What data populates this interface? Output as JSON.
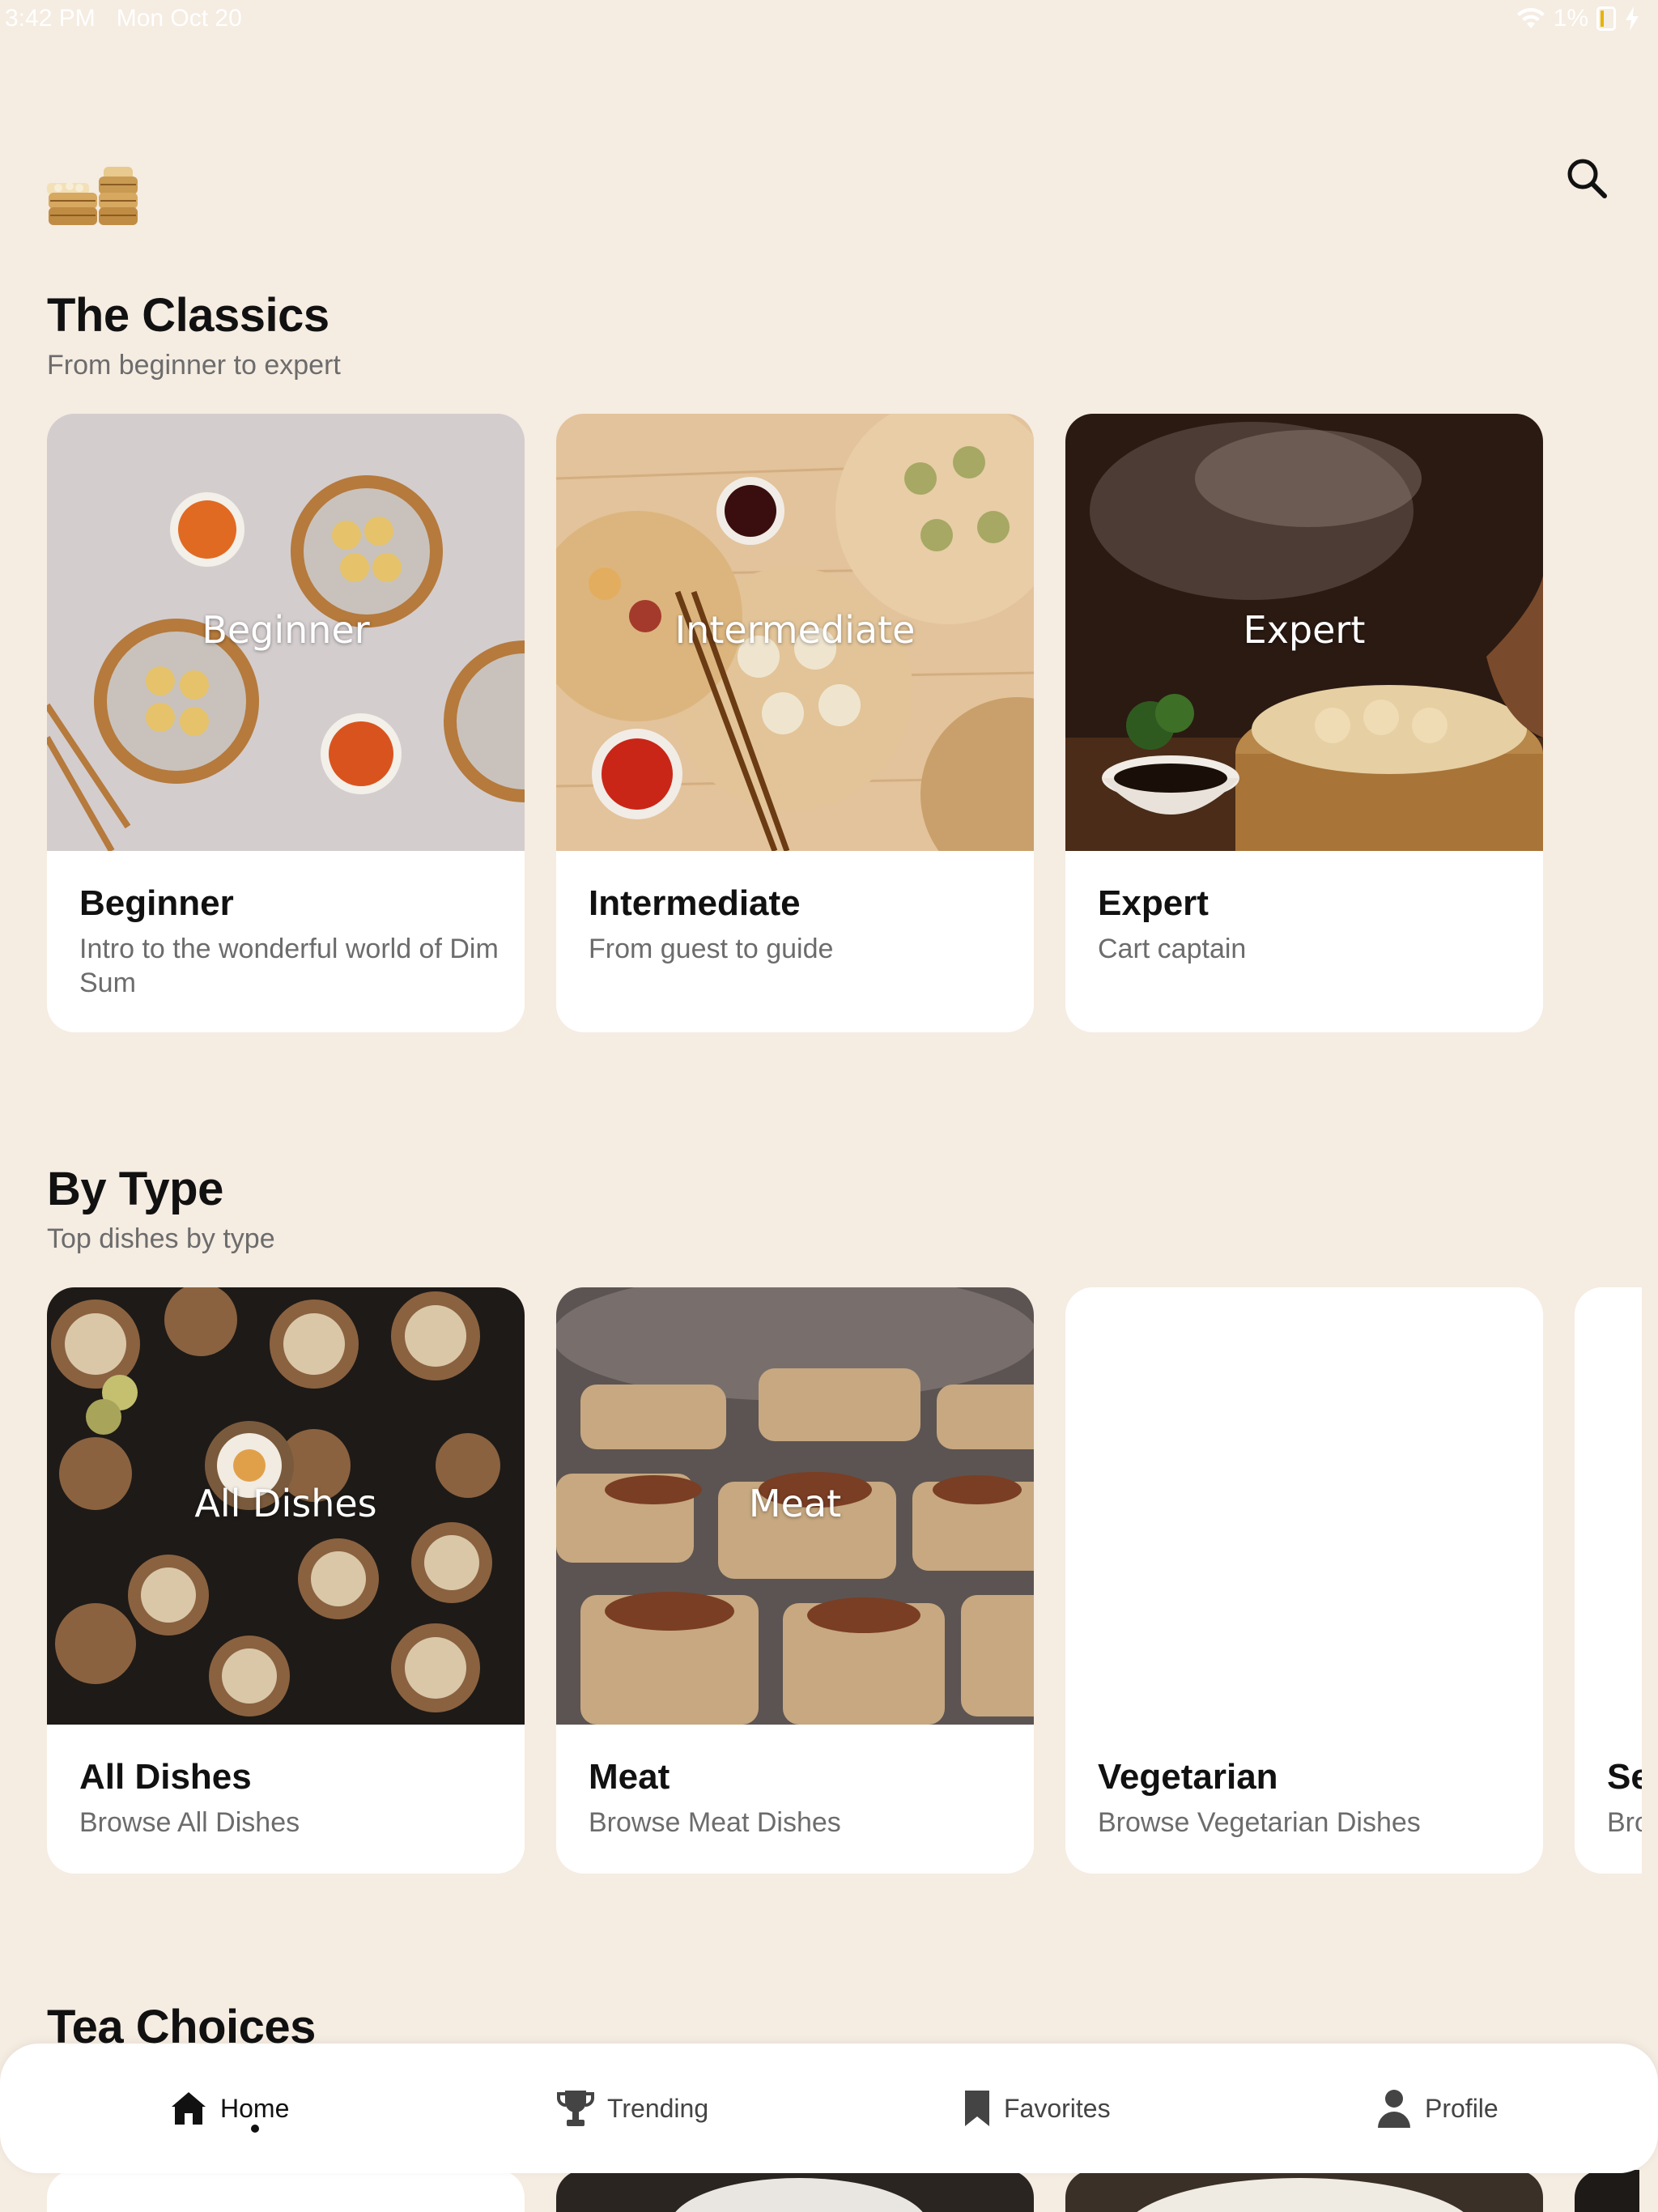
{
  "status_bar": {
    "time": "3:42 PM",
    "date": "Mon Oct 20",
    "battery": "1%"
  },
  "header": {
    "logo_icon": "dim-sum-steamer-logo",
    "search_icon": "search-icon"
  },
  "sections": [
    {
      "title": "The Classics",
      "subtitle": "From beginner to expert",
      "cards": [
        {
          "overlay": "Beginner",
          "title": "Beginner",
          "subtitle": "Intro to the wonderful world of Dim Sum"
        },
        {
          "overlay": "Intermediate",
          "title": "Intermediate",
          "subtitle": "From guest to guide"
        },
        {
          "overlay": "Expert",
          "title": "Expert",
          "subtitle": "Cart captain"
        }
      ]
    },
    {
      "title": "By Type",
      "subtitle": "Top dishes by type",
      "cards": [
        {
          "overlay": "All Dishes",
          "title": "All Dishes",
          "subtitle": "Browse All Dishes"
        },
        {
          "overlay": "Meat",
          "title": "Meat",
          "subtitle": "Browse Meat Dishes"
        },
        {
          "overlay": "",
          "title": "Vegetarian",
          "subtitle": "Browse Vegetarian Dishes"
        },
        {
          "overlay": "",
          "title": "Se",
          "subtitle": "Bro"
        }
      ]
    },
    {
      "title": "Tea Choices"
    }
  ],
  "nav": {
    "items": [
      {
        "label": "Home",
        "icon": "home-icon",
        "active": true
      },
      {
        "label": "Trending",
        "icon": "trophy-icon",
        "active": false
      },
      {
        "label": "Favorites",
        "icon": "bookmark-icon",
        "active": false
      },
      {
        "label": "Profile",
        "icon": "person-icon",
        "active": false
      }
    ]
  },
  "colors": {
    "background": "#f5ece2",
    "card": "#ffffff",
    "text": "#111111",
    "muted": "#6c6c6c"
  }
}
